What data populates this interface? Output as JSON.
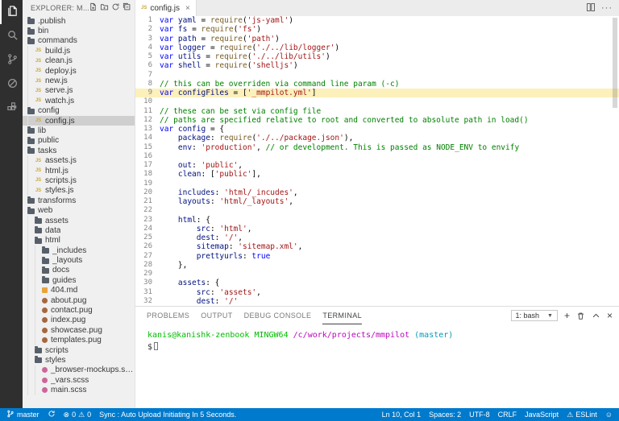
{
  "activity_bar": {
    "items": [
      {
        "name": "explorer",
        "active": true
      },
      {
        "name": "search",
        "active": false
      },
      {
        "name": "source-control",
        "active": false
      },
      {
        "name": "debug",
        "active": false
      },
      {
        "name": "extensions",
        "active": false
      }
    ]
  },
  "sidebar": {
    "header": "EXPLORER: M...",
    "tree": [
      {
        "label": ".publish",
        "icon": "folder",
        "depth": 0
      },
      {
        "label": "bin",
        "icon": "folder",
        "depth": 0
      },
      {
        "label": "commands",
        "icon": "folder",
        "depth": 0
      },
      {
        "label": "build.js",
        "icon": "js",
        "depth": 1
      },
      {
        "label": "clean.js",
        "icon": "js",
        "depth": 1
      },
      {
        "label": "deploy.js",
        "icon": "js",
        "depth": 1
      },
      {
        "label": "new.js",
        "icon": "js",
        "depth": 1
      },
      {
        "label": "serve.js",
        "icon": "js",
        "depth": 1
      },
      {
        "label": "watch.js",
        "icon": "js",
        "depth": 1
      },
      {
        "label": "config",
        "icon": "folder",
        "depth": 0
      },
      {
        "label": "config.js",
        "icon": "js",
        "depth": 1,
        "selected": true
      },
      {
        "label": "lib",
        "icon": "folder",
        "depth": 0
      },
      {
        "label": "public",
        "icon": "folder",
        "depth": 0
      },
      {
        "label": "tasks",
        "icon": "folder",
        "depth": 0
      },
      {
        "label": "assets.js",
        "icon": "js",
        "depth": 1
      },
      {
        "label": "html.js",
        "icon": "js",
        "depth": 1
      },
      {
        "label": "scripts.js",
        "icon": "js",
        "depth": 1
      },
      {
        "label": "styles.js",
        "icon": "js",
        "depth": 1
      },
      {
        "label": "transforms",
        "icon": "folder",
        "depth": 0
      },
      {
        "label": "web",
        "icon": "folder",
        "depth": 0
      },
      {
        "label": "assets",
        "icon": "folder",
        "depth": 1
      },
      {
        "label": "data",
        "icon": "folder",
        "depth": 1
      },
      {
        "label": "html",
        "icon": "folder",
        "depth": 1
      },
      {
        "label": "_includes",
        "icon": "folder",
        "depth": 2
      },
      {
        "label": "_layouts",
        "icon": "folder",
        "depth": 2
      },
      {
        "label": "docs",
        "icon": "folder",
        "depth": 2
      },
      {
        "label": "guides",
        "icon": "folder",
        "depth": 2
      },
      {
        "label": "404.md",
        "icon": "md",
        "depth": 2
      },
      {
        "label": "about.pug",
        "icon": "pug",
        "depth": 2
      },
      {
        "label": "contact.pug",
        "icon": "pug",
        "depth": 2
      },
      {
        "label": "index.pug",
        "icon": "pug",
        "depth": 2
      },
      {
        "label": "showcase.pug",
        "icon": "pug",
        "depth": 2
      },
      {
        "label": "templates.pug",
        "icon": "pug",
        "depth": 2
      },
      {
        "label": "scripts",
        "icon": "folder",
        "depth": 1
      },
      {
        "label": "styles",
        "icon": "folder",
        "depth": 1
      },
      {
        "label": "_browser-mockups.scss",
        "icon": "scss",
        "depth": 2
      },
      {
        "label": "_vars.scss",
        "icon": "scss",
        "depth": 2
      },
      {
        "label": "main.scss",
        "icon": "scss",
        "depth": 2
      }
    ]
  },
  "editor": {
    "tab": {
      "label": "config.js",
      "icon_text": "JS",
      "close": "×"
    },
    "highlighted_line": 9,
    "lines": [
      {
        "n": 1,
        "s": [
          [
            "kw",
            "var "
          ],
          [
            "vr",
            "yaml"
          ],
          [
            "pl",
            " = "
          ],
          [
            "fn",
            "require"
          ],
          [
            "pl",
            "("
          ],
          [
            "str",
            "'js-yaml'"
          ],
          [
            "pl",
            ")"
          ]
        ]
      },
      {
        "n": 2,
        "s": [
          [
            "kw",
            "var "
          ],
          [
            "vr",
            "fs"
          ],
          [
            "pl",
            " = "
          ],
          [
            "fn",
            "require"
          ],
          [
            "pl",
            "("
          ],
          [
            "str",
            "'fs'"
          ],
          [
            "pl",
            ")"
          ]
        ]
      },
      {
        "n": 3,
        "s": [
          [
            "kw",
            "var "
          ],
          [
            "vr",
            "path"
          ],
          [
            "pl",
            " = "
          ],
          [
            "fn",
            "require"
          ],
          [
            "pl",
            "("
          ],
          [
            "str",
            "'path'"
          ],
          [
            "pl",
            ")"
          ]
        ]
      },
      {
        "n": 4,
        "s": [
          [
            "kw",
            "var "
          ],
          [
            "vr",
            "logger"
          ],
          [
            "pl",
            " = "
          ],
          [
            "fn",
            "require"
          ],
          [
            "pl",
            "("
          ],
          [
            "str",
            "'./../lib/logger'"
          ],
          [
            "pl",
            ")"
          ]
        ]
      },
      {
        "n": 5,
        "s": [
          [
            "kw",
            "var "
          ],
          [
            "vr",
            "utils"
          ],
          [
            "pl",
            " = "
          ],
          [
            "fn",
            "require"
          ],
          [
            "pl",
            "("
          ],
          [
            "str",
            "'./../lib/utils'"
          ],
          [
            "pl",
            ")"
          ]
        ]
      },
      {
        "n": 6,
        "s": [
          [
            "kw",
            "var "
          ],
          [
            "vr",
            "shell"
          ],
          [
            "pl",
            " = "
          ],
          [
            "fn",
            "require"
          ],
          [
            "pl",
            "("
          ],
          [
            "str",
            "'shelljs'"
          ],
          [
            "pl",
            ")"
          ]
        ]
      },
      {
        "n": 7,
        "s": []
      },
      {
        "n": 8,
        "s": [
          [
            "cm",
            "// this can be overriden via command line param (-c)"
          ]
        ]
      },
      {
        "n": 9,
        "s": [
          [
            "kw",
            "var "
          ],
          [
            "vr",
            "configFiles"
          ],
          [
            "pl",
            " = ["
          ],
          [
            "str",
            "'_mmpilot.yml'"
          ],
          [
            "pl",
            "]"
          ]
        ]
      },
      {
        "n": 10,
        "s": []
      },
      {
        "n": 11,
        "s": [
          [
            "cm",
            "// these can be set via config file"
          ]
        ]
      },
      {
        "n": 12,
        "s": [
          [
            "cm",
            "// paths are specified relative to root and converted to absolute path in load()"
          ]
        ]
      },
      {
        "n": 13,
        "s": [
          [
            "kw",
            "var "
          ],
          [
            "vr",
            "config"
          ],
          [
            "pl",
            " = {"
          ]
        ]
      },
      {
        "n": 14,
        "s": [
          [
            "pl",
            "    "
          ],
          [
            "vr",
            "package"
          ],
          [
            "pl",
            ": "
          ],
          [
            "fn",
            "require"
          ],
          [
            "pl",
            "("
          ],
          [
            "str",
            "'./../package.json'"
          ],
          [
            "pl",
            "),"
          ]
        ]
      },
      {
        "n": 15,
        "s": [
          [
            "pl",
            "    "
          ],
          [
            "vr",
            "env"
          ],
          [
            "pl",
            ": "
          ],
          [
            "str",
            "'production'"
          ],
          [
            "pl",
            ", "
          ],
          [
            "cm",
            "// or development. This is passed as NODE_ENV to envify"
          ]
        ]
      },
      {
        "n": 16,
        "s": []
      },
      {
        "n": 17,
        "s": [
          [
            "pl",
            "    "
          ],
          [
            "vr",
            "out"
          ],
          [
            "pl",
            ": "
          ],
          [
            "str",
            "'public'"
          ],
          [
            "pl",
            ","
          ]
        ]
      },
      {
        "n": 18,
        "s": [
          [
            "pl",
            "    "
          ],
          [
            "vr",
            "clean"
          ],
          [
            "pl",
            ": ["
          ],
          [
            "str",
            "'public'"
          ],
          [
            "pl",
            "],"
          ]
        ]
      },
      {
        "n": 19,
        "s": []
      },
      {
        "n": 20,
        "s": [
          [
            "pl",
            "    "
          ],
          [
            "vr",
            "includes"
          ],
          [
            "pl",
            ": "
          ],
          [
            "str",
            "'html/_incudes'"
          ],
          [
            "pl",
            ","
          ]
        ]
      },
      {
        "n": 21,
        "s": [
          [
            "pl",
            "    "
          ],
          [
            "vr",
            "layouts"
          ],
          [
            "pl",
            ": "
          ],
          [
            "str",
            "'html/_layouts'"
          ],
          [
            "pl",
            ","
          ]
        ]
      },
      {
        "n": 22,
        "s": []
      },
      {
        "n": 23,
        "s": [
          [
            "pl",
            "    "
          ],
          [
            "vr",
            "html"
          ],
          [
            "pl",
            ": {"
          ]
        ]
      },
      {
        "n": 24,
        "s": [
          [
            "pl",
            "        "
          ],
          [
            "vr",
            "src"
          ],
          [
            "pl",
            ": "
          ],
          [
            "str",
            "'html'"
          ],
          [
            "pl",
            ","
          ]
        ]
      },
      {
        "n": 25,
        "s": [
          [
            "pl",
            "        "
          ],
          [
            "vr",
            "dest"
          ],
          [
            "pl",
            ": "
          ],
          [
            "str",
            "'/'"
          ],
          [
            "pl",
            ","
          ]
        ]
      },
      {
        "n": 26,
        "s": [
          [
            "pl",
            "        "
          ],
          [
            "vr",
            "sitemap"
          ],
          [
            "pl",
            ": "
          ],
          [
            "str",
            "'sitemap.xml'"
          ],
          [
            "pl",
            ","
          ]
        ]
      },
      {
        "n": 27,
        "s": [
          [
            "pl",
            "        "
          ],
          [
            "vr",
            "prettyurls"
          ],
          [
            "pl",
            ": "
          ],
          [
            "kw",
            "true"
          ]
        ]
      },
      {
        "n": 28,
        "s": [
          [
            "pl",
            "    },"
          ]
        ]
      },
      {
        "n": 29,
        "s": []
      },
      {
        "n": 30,
        "s": [
          [
            "pl",
            "    "
          ],
          [
            "vr",
            "assets"
          ],
          [
            "pl",
            ": {"
          ]
        ]
      },
      {
        "n": 31,
        "s": [
          [
            "pl",
            "        "
          ],
          [
            "vr",
            "src"
          ],
          [
            "pl",
            ": "
          ],
          [
            "str",
            "'assets'"
          ],
          [
            "pl",
            ","
          ]
        ]
      },
      {
        "n": 32,
        "s": [
          [
            "pl",
            "        "
          ],
          [
            "vr",
            "dest"
          ],
          [
            "pl",
            ": "
          ],
          [
            "str",
            "'/'"
          ]
        ]
      }
    ]
  },
  "panel": {
    "tabs": [
      {
        "label": "PROBLEMS",
        "active": false
      },
      {
        "label": "OUTPUT",
        "active": false
      },
      {
        "label": "DEBUG CONSOLE",
        "active": false
      },
      {
        "label": "TERMINAL",
        "active": true
      }
    ],
    "shell_select": "1: bash",
    "terminal": {
      "prompt_user": "kanis@kanishk-zenbook MINGW64",
      "prompt_path": " /c/work/projects/mmpilot",
      "prompt_branch": " (master)",
      "input_prompt": "$"
    }
  },
  "status_bar": {
    "branch_label": "master",
    "error_count": "0",
    "warning_count": "0",
    "sync_message": "Sync : Auto Upload Initiating In 5 Seconds.",
    "cursor": "Ln 10, Col 1",
    "indent": "Spaces: 2",
    "encoding": "UTF-8",
    "eol": "CRLF",
    "language": "JavaScript",
    "linter": "ESLint",
    "warning_glyph": "⚠",
    "error_glyph": "⊗",
    "smiley_glyph": "☺"
  }
}
